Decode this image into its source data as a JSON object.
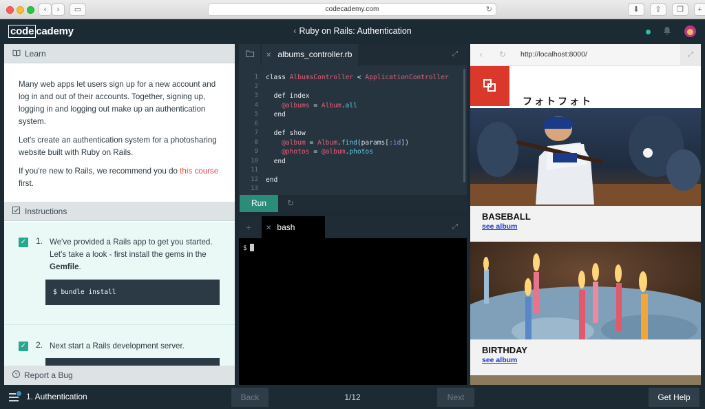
{
  "browser": {
    "url": "codecademy.com",
    "back": "‹",
    "forward": "›"
  },
  "header": {
    "logo_box": "code",
    "logo_rest": "cademy",
    "course_title": "Ruby on Rails: Authentication"
  },
  "learn": {
    "heading": "Learn",
    "paragraphs": [
      "Many web apps let users sign up for a new account and log in and out of their accounts. Together, signing up, logging in and logging out make up an authentication system.",
      "Let's create an authentication system for a photosharing website built with Ruby on Rails."
    ],
    "p3_before": "If you're new to Rails, we recommend you do ",
    "p3_link": "this course",
    "p3_after": "first."
  },
  "instructions": {
    "heading": "Instructions",
    "steps": [
      {
        "num": "1.",
        "text_a": "We've provided a Rails app to get you started. Let's take a look - first install the gems in the ",
        "bold": "Gemfile",
        "text_b": ".",
        "code": "$ bundle install"
      },
      {
        "num": "2.",
        "text": "Next start a Rails development server."
      }
    ]
  },
  "report_bug": "Report a Bug",
  "editor": {
    "tab_name": "albums_controller.rb",
    "line_numbers": [
      "1",
      "2",
      "3",
      "4",
      "5",
      "6",
      "7",
      "8",
      "9",
      "10",
      "11",
      "12",
      "13"
    ],
    "run_label": "Run"
  },
  "terminal": {
    "tab_name": "bash",
    "prompt": "$"
  },
  "preview": {
    "url": "http://localhost:8000/",
    "site_name": "フォトフォト",
    "albums": [
      {
        "title": "BASEBALL",
        "link": "see album"
      },
      {
        "title": "BIRTHDAY",
        "link": "see album"
      }
    ]
  },
  "footer": {
    "lesson": "1. Authentication",
    "back": "Back",
    "page": "1/12",
    "next": "Next",
    "help": "Get Help"
  },
  "colors": {
    "app_bg": "#1c2a33",
    "accent_green": "#2a8c79",
    "logo_red": "#d9382b",
    "link_red": "#e1504b"
  }
}
